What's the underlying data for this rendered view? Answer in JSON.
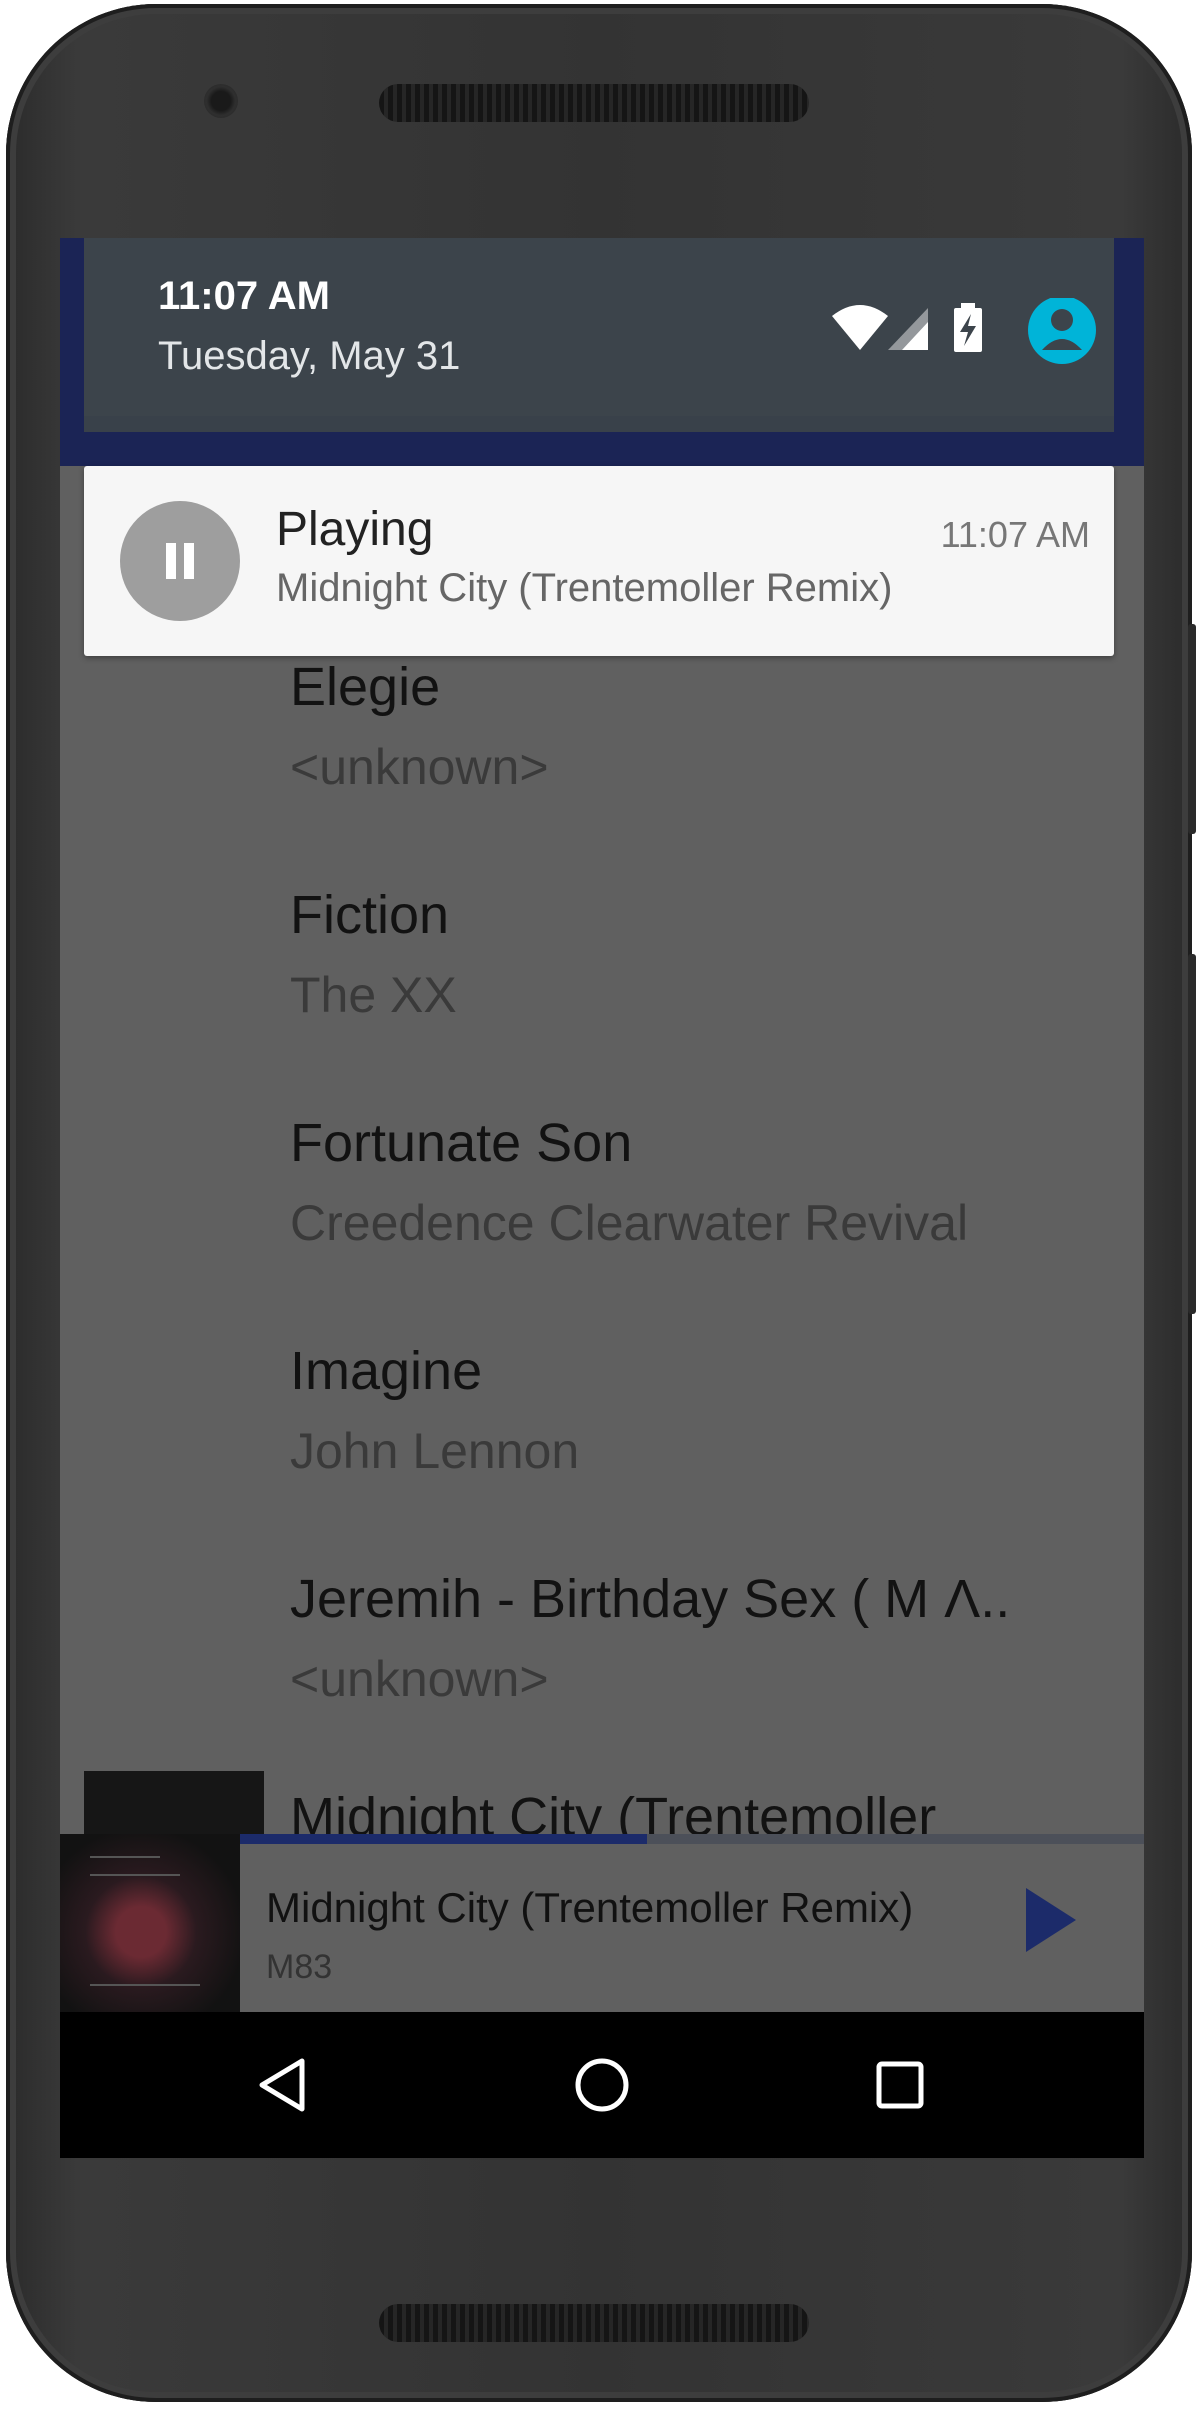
{
  "status": {
    "time": "11:07 AM",
    "date": "Tuesday, May 31",
    "icons": [
      "wifi-icon",
      "signal-icon",
      "battery-charging-icon",
      "account-icon"
    ],
    "account_color": "#00b4d8"
  },
  "notification": {
    "title": "Playing",
    "subtitle": "Midnight City (Trentemoller Remix)",
    "time": "11:07 AM"
  },
  "tracks": [
    {
      "title": "Elegie",
      "artist": "<unknown>"
    },
    {
      "title": "Fiction",
      "artist": "The XX"
    },
    {
      "title": "Fortunate Son",
      "artist": "Creedence Clearwater Revival"
    },
    {
      "title": "Imagine",
      "artist": "John Lennon"
    },
    {
      "title": "Jeremih - Birthday Sex ( M Λ..",
      "artist": "<unknown>"
    }
  ],
  "partial_track": "Midnight City (Trentemoller",
  "player": {
    "title": "Midnight City (Trentemoller Remix)",
    "artist": "M83",
    "progress_fraction": 0.45,
    "accent": "#1c2b6a"
  },
  "navbar": [
    "back-icon",
    "home-icon",
    "recents-icon"
  ]
}
